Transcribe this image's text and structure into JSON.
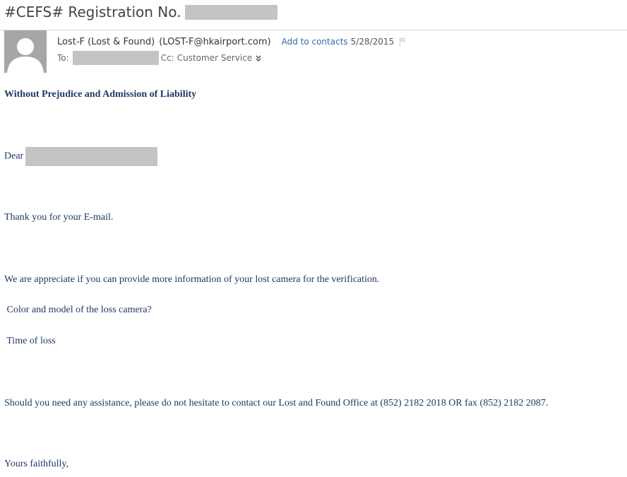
{
  "subject": {
    "prefix": "#CEFS# Registration No."
  },
  "sender": {
    "name": "Lost-F (Lost & Found)",
    "email": "(LOST-F@hkairport.com)",
    "add_contacts": "Add to contacts",
    "date": "5/28/2015"
  },
  "recipients": {
    "to_label": "To:",
    "cc_label": "Cc:",
    "cc_value": "Customer Service"
  },
  "body": {
    "heading": "Without Prejudice and Admission of Liability",
    "greeting": "Dear",
    "p1": "Thank you for your E-mail.",
    "p2": "We are appreciate if you can provide more information of your lost camera for the verification.",
    "q1": " Color and model of the loss camera?",
    "q2": " Time of loss",
    "p3": "Should you need any assistance, please do not hesitate to contact our Lost and Found Office at (852) 2182 2018 OR fax (852) 2182 2087.",
    "closing": "Yours faithfully,"
  },
  "colors": {
    "link": "#2f6ca8",
    "body_text": "#1f3864",
    "redaction": "#c4c4c4",
    "avatar_bg": "#a6a6a6"
  },
  "icons": {
    "avatar": "person-silhouette-icon",
    "flag": "flag-icon",
    "expand": "double-chevron-down-icon"
  }
}
